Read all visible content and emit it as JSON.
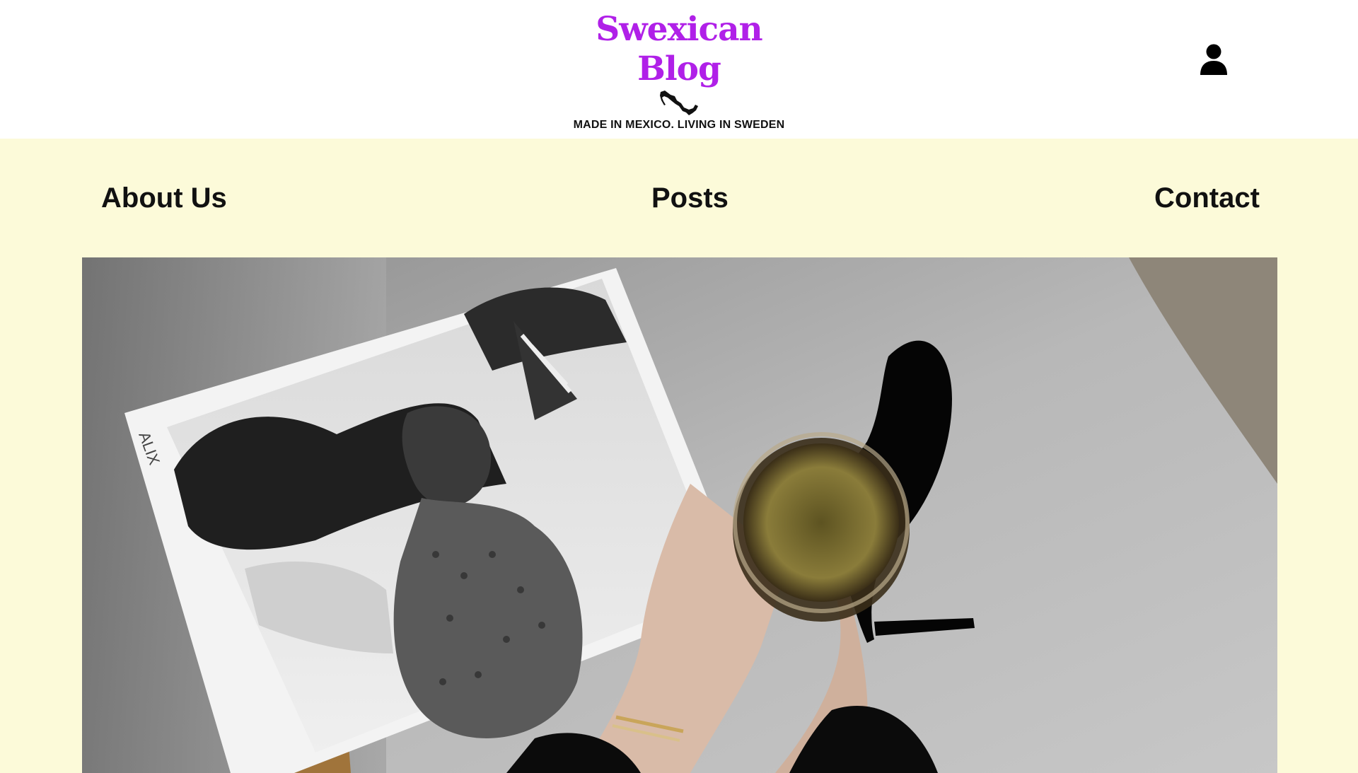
{
  "header": {
    "brand_title": "Swexican Blog",
    "brand_tagline": "MADE IN MEXICO. LIVING IN SWEDEN",
    "brand_color": "#b020e8",
    "user_icon": "user-icon"
  },
  "nav": {
    "background": "#fcfad9",
    "items": [
      {
        "label": "About Us"
      },
      {
        "label": "Posts"
      },
      {
        "label": "Contact"
      }
    ]
  },
  "hero": {
    "image_icon": "hero-photo",
    "spine_text": "ALIX"
  }
}
